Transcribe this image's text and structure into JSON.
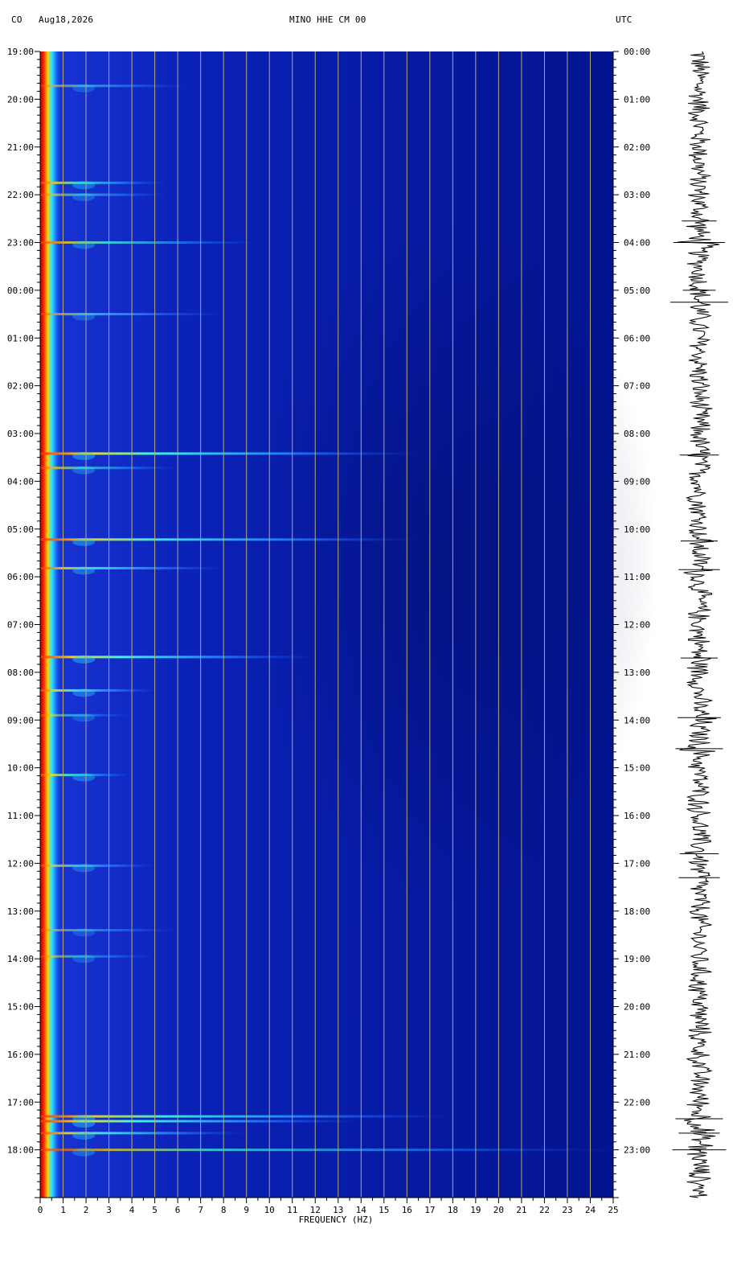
{
  "header": {
    "network": "CO",
    "date": "Aug18,2026",
    "channel": "MINO HHE CM 00",
    "timezone": "UTC"
  },
  "colors": {
    "background": "#ffffff",
    "spectrogram_base": "#0a1eb4",
    "spectrogram_dark": "#04127e",
    "gridline": "#b4aa78",
    "seismogram": "#000000"
  },
  "chart_data": {
    "type": "heatmap",
    "xlabel": "FREQUENCY (HZ)",
    "xlim": [
      0,
      25
    ],
    "x_ticks": [
      "0",
      "1",
      "2",
      "3",
      "4",
      "5",
      "6",
      "7",
      "8",
      "9",
      "10",
      "11",
      "12",
      "13",
      "14",
      "15",
      "16",
      "17",
      "18",
      "19",
      "20",
      "21",
      "22",
      "23",
      "24",
      "25"
    ],
    "left_time_labels": [
      "19:00",
      "20:00",
      "21:00",
      "22:00",
      "23:00",
      "00:00",
      "01:00",
      "02:00",
      "03:00",
      "04:00",
      "05:00",
      "06:00",
      "07:00",
      "08:00",
      "09:00",
      "10:00",
      "11:00",
      "12:00",
      "13:00",
      "14:00",
      "15:00",
      "16:00",
      "17:00",
      "18:00"
    ],
    "right_time_labels": [
      "00:00",
      "01:00",
      "02:00",
      "03:00",
      "04:00",
      "05:00",
      "06:00",
      "07:00",
      "08:00",
      "09:00",
      "10:00",
      "11:00",
      "12:00",
      "13:00",
      "14:00",
      "15:00",
      "16:00",
      "17:00",
      "18:00",
      "19:00",
      "20:00",
      "21:00",
      "22:00",
      "23:00"
    ],
    "duration_hours": 24,
    "events": [
      {
        "hour": 0.72,
        "max_freq": 6.5,
        "strength": 0.55
      },
      {
        "hour": 2.75,
        "max_freq": 5.5,
        "strength": 0.8
      },
      {
        "hour": 3.0,
        "max_freq": 5.5,
        "strength": 0.6
      },
      {
        "hour": 4.0,
        "max_freq": 9.5,
        "strength": 0.75
      },
      {
        "hour": 5.5,
        "max_freq": 8.0,
        "strength": 0.6
      },
      {
        "hour": 8.42,
        "max_freq": 16.5,
        "strength": 0.95
      },
      {
        "hour": 8.72,
        "max_freq": 6.0,
        "strength": 0.7
      },
      {
        "hour": 10.22,
        "max_freq": 16.5,
        "strength": 0.9
      },
      {
        "hour": 10.82,
        "max_freq": 8.0,
        "strength": 0.8
      },
      {
        "hour": 12.68,
        "max_freq": 12.0,
        "strength": 0.95
      },
      {
        "hour": 13.38,
        "max_freq": 5.0,
        "strength": 0.85
      },
      {
        "hour": 13.9,
        "max_freq": 4.0,
        "strength": 0.55
      },
      {
        "hour": 15.15,
        "max_freq": 4.0,
        "strength": 0.8
      },
      {
        "hour": 17.05,
        "max_freq": 5.0,
        "strength": 0.7
      },
      {
        "hour": 18.4,
        "max_freq": 6.0,
        "strength": 0.5
      },
      {
        "hour": 18.95,
        "max_freq": 5.0,
        "strength": 0.55
      },
      {
        "hour": 22.3,
        "max_freq": 18.0,
        "strength": 0.9
      },
      {
        "hour": 22.4,
        "max_freq": 14.0,
        "strength": 0.95
      },
      {
        "hour": 22.65,
        "max_freq": 9.0,
        "strength": 0.85
      },
      {
        "hour": 23.0,
        "max_freq": 25.0,
        "strength": 0.7
      }
    ],
    "seismogram_bursts": [
      {
        "hour": 3.55,
        "amplitude": 0.45
      },
      {
        "hour": 4.0,
        "amplitude": 0.85
      },
      {
        "hour": 5.0,
        "amplitude": 0.4
      },
      {
        "hour": 5.25,
        "amplitude": 1.0
      },
      {
        "hour": 8.45,
        "amplitude": 0.55
      },
      {
        "hour": 10.25,
        "amplitude": 0.5
      },
      {
        "hour": 10.85,
        "amplitude": 0.6
      },
      {
        "hour": 12.7,
        "amplitude": 0.5
      },
      {
        "hour": 13.95,
        "amplitude": 0.65
      },
      {
        "hour": 14.6,
        "amplitude": 0.75
      },
      {
        "hour": 16.8,
        "amplitude": 0.55
      },
      {
        "hour": 17.3,
        "amplitude": 0.6
      },
      {
        "hour": 22.35,
        "amplitude": 0.75
      },
      {
        "hour": 22.65,
        "amplitude": 0.6
      },
      {
        "hour": 23.0,
        "amplitude": 0.9
      }
    ]
  }
}
